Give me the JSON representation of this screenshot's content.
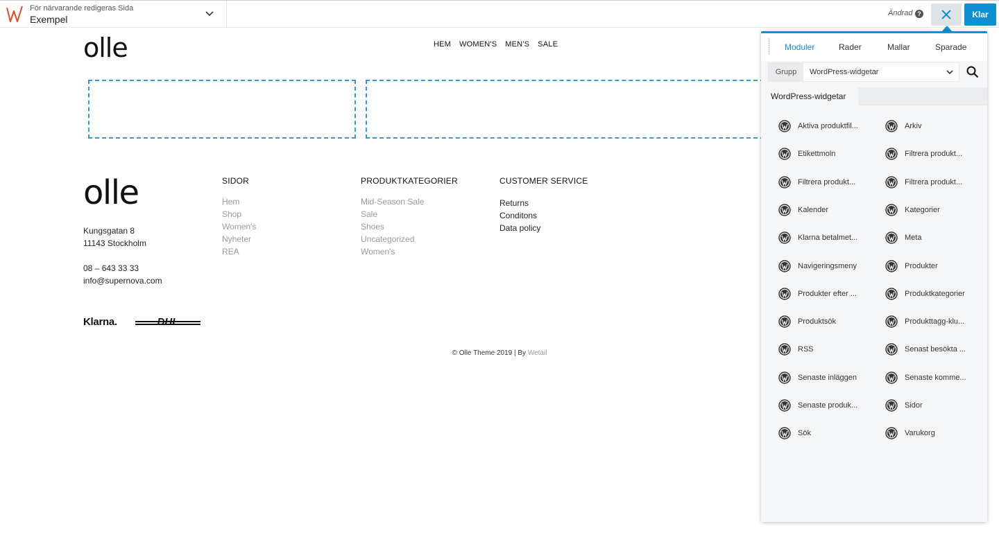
{
  "topbar": {
    "subtitle": "För närvarande redigeras Sida",
    "title": "Exempel",
    "changed": "Ändrad",
    "help": "?",
    "done": "Klar"
  },
  "site": {
    "logo": "olle",
    "nav": [
      "HEM",
      "WOMEN'S",
      "MEN'S",
      "SALE"
    ]
  },
  "footer": {
    "logo": "olle",
    "address": [
      "Kungsgatan 8",
      "11143 Stockholm"
    ],
    "contact": [
      "08 – 643 33 33",
      "info@supernova.com"
    ],
    "columns": [
      {
        "title": "SIDOR",
        "items": [
          "Hem",
          "Shop",
          "Women's",
          "Nyheter",
          "REA"
        ]
      },
      {
        "title": "PRODUKTKATEGORIER",
        "items": [
          "Mid-Season Sale",
          "Sale",
          "Shoes",
          "Uncategorized",
          "Women's"
        ]
      },
      {
        "title": "CUSTOMER SERVICE",
        "items": [
          "Returns",
          "Conditons",
          "Data policy"
        ]
      }
    ],
    "klarna": "Klarna.",
    "dhl": "DHL",
    "copyright": "© Olle Theme 2019 | By",
    "copyright_link": "Wetail"
  },
  "panel": {
    "tabs": [
      "Moduler",
      "Rader",
      "Mallar",
      "Sparade"
    ],
    "group_label": "Grupp",
    "group_value": "WordPress-widgetar",
    "section": "WordPress-widgetar",
    "widgets": [
      "Aktiva produktfil...",
      "Arkiv",
      "Etikettmoln",
      "Filtrera produkt...",
      "Filtrera produkt...",
      "Filtrera produkt...",
      "Kalender",
      "Kategorier",
      "Klarna betalmet...",
      "Meta",
      "Navigeringsmeny",
      "Produkter",
      "Produkter efter ...",
      "Produktkategorier",
      "Produktsök",
      "Produkttagg-klu...",
      "RSS",
      "Senast besökta ...",
      "Senaste inläggen",
      "Senaste komme...",
      "Senaste produk...",
      "Sidor",
      "Sök",
      "Varukorg"
    ]
  },
  "colors": {
    "accent": "#0e90d2",
    "dashed": "#2a9fd8"
  }
}
